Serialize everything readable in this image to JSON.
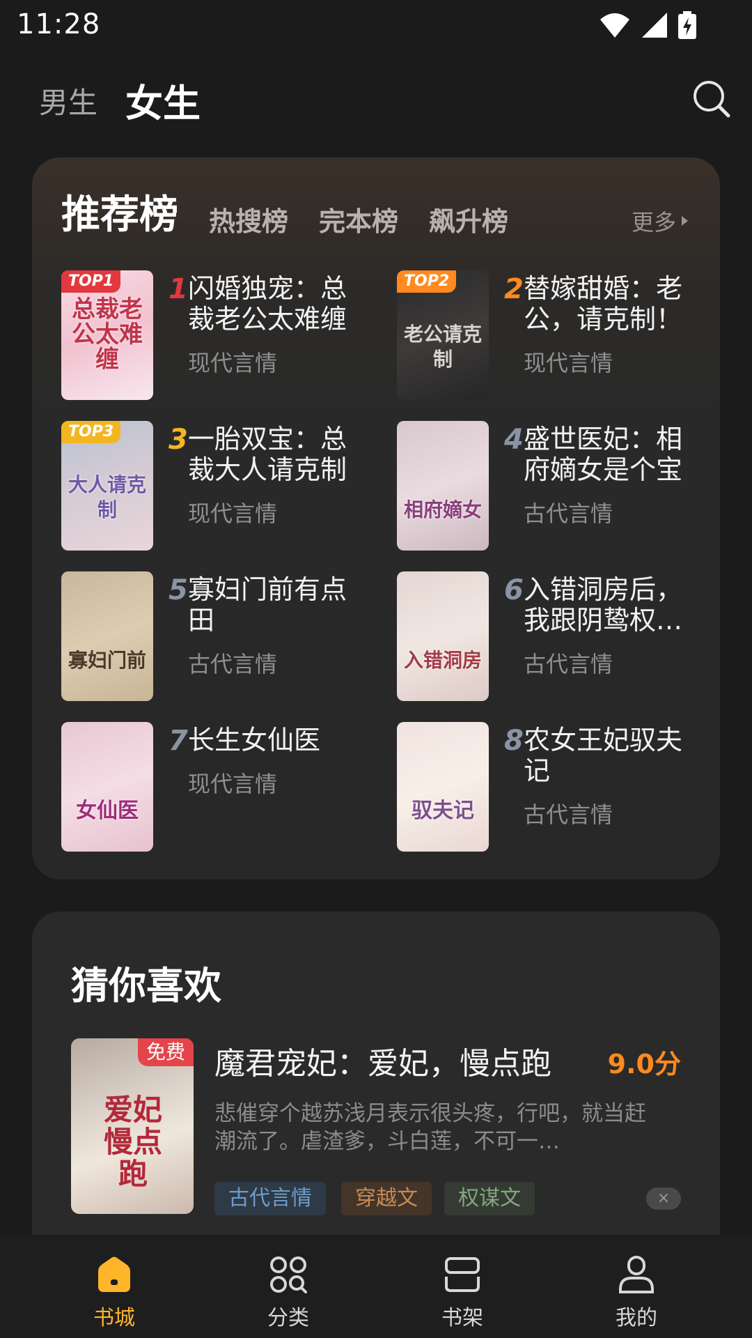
{
  "status_bar": {
    "time": "11:28"
  },
  "top_nav": {
    "male_tab": "男生",
    "female_tab": "女生"
  },
  "ranking": {
    "tabs": [
      "推荐榜",
      "热搜榜",
      "完本榜",
      "飙升榜"
    ],
    "more": "更多",
    "books": [
      {
        "rank": "1",
        "badge": "TOP1",
        "title": "闪婚独宠：总裁老公太难缠",
        "genre": "现代言情",
        "cover_text": "总裁老公太难缠",
        "rank_color": "#e2383f",
        "badge_color": "#e2383f"
      },
      {
        "rank": "2",
        "badge": "TOP2",
        "title": "替嫁甜婚：老公，请克制！",
        "genre": "现代言情",
        "cover_text": "老公请克制",
        "rank_color": "#ff8a1f",
        "badge_color": "#ff8a1f"
      },
      {
        "rank": "3",
        "badge": "TOP3",
        "title": "一胎双宝：总裁大人请克制",
        "genre": "现代言情",
        "cover_text": "大人请克制",
        "rank_color": "#f3b622",
        "badge_color": "#f3b622"
      },
      {
        "rank": "4",
        "badge": "",
        "title": "盛世医妃：相府嫡女是个宝",
        "genre": "古代言情",
        "cover_text": "相府嫡女",
        "rank_color": "#8a94a6",
        "badge_color": ""
      },
      {
        "rank": "5",
        "badge": "",
        "title": "寡妇门前有点田",
        "genre": "古代言情",
        "cover_text": "寡妇门前",
        "rank_color": "#8a94a6",
        "badge_color": ""
      },
      {
        "rank": "6",
        "badge": "",
        "title": "入错洞房后，我跟阴鸷权…",
        "genre": "古代言情",
        "cover_text": "入错洞房",
        "rank_color": "#8a94a6",
        "badge_color": ""
      },
      {
        "rank": "7",
        "badge": "",
        "title": "长生女仙医",
        "genre": "现代言情",
        "cover_text": "女仙医",
        "rank_color": "#8a94a6",
        "badge_color": ""
      },
      {
        "rank": "8",
        "badge": "",
        "title": "农女王妃驭夫记",
        "genre": "古代言情",
        "cover_text": "驭夫记",
        "rank_color": "#8a94a6",
        "badge_color": ""
      }
    ]
  },
  "guess": {
    "section_title": "猜你喜欢",
    "free_badge": "免费",
    "cover_text": "爱妃慢点跑",
    "book_title": "魔君宠妃：爱妃，慢点跑",
    "score": "9.0分",
    "description": "悲催穿个越苏浅月表示很头疼，行吧，就当赶潮流了。虐渣爹，斗白莲，不可一…",
    "tags": [
      "古代言情",
      "穿越文",
      "权谋文"
    ],
    "dismiss": "×"
  },
  "bottom_nav": {
    "items": [
      {
        "label": "书城",
        "icon": "home-icon",
        "active": true
      },
      {
        "label": "分类",
        "icon": "category-icon",
        "active": false
      },
      {
        "label": "书架",
        "icon": "bookshelf-icon",
        "active": false
      },
      {
        "label": "我的",
        "icon": "profile-icon",
        "active": false
      }
    ]
  },
  "colors": {
    "accent": "#ffb52a",
    "score": "#ff8a1f",
    "free": "#e4454a"
  }
}
